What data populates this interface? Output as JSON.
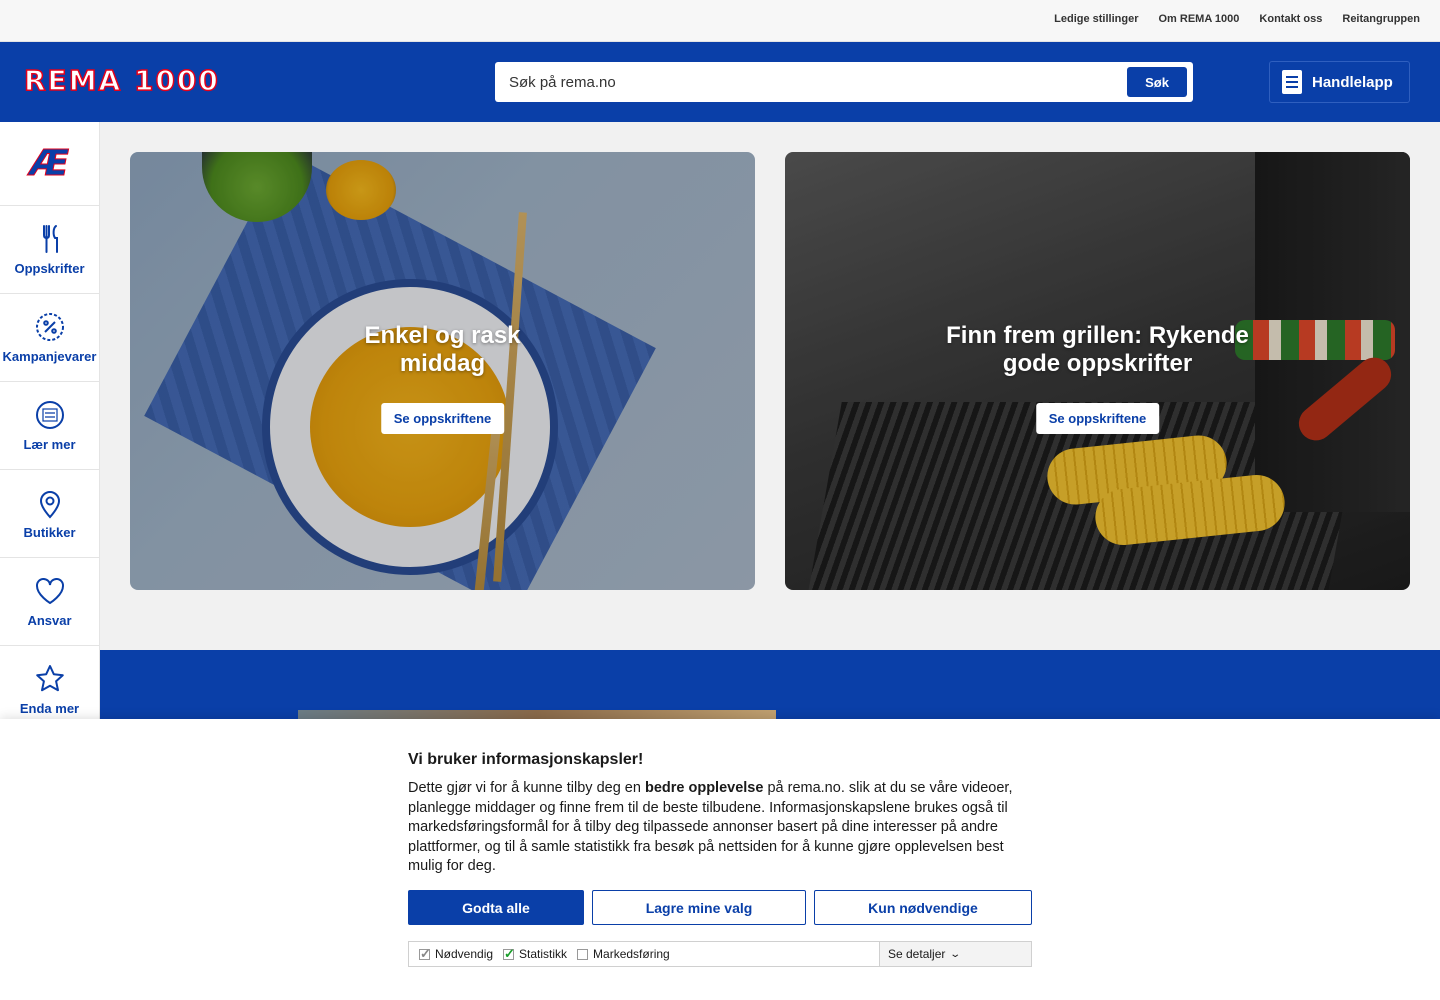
{
  "topbar": {
    "links": [
      "Ledige stillinger",
      "Om REMA 1000",
      "Kontakt oss",
      "Reitangruppen"
    ]
  },
  "header": {
    "logo": "REMA 1000",
    "search_placeholder": "Søk på rema.no",
    "search_button": "Søk",
    "shopping_list": "Handlelapp"
  },
  "sidebar": {
    "brand_mark": "Æ",
    "items": [
      {
        "label": "Oppskrifter",
        "icon": "cutlery-icon"
      },
      {
        "label": "Kampanjevarer",
        "icon": "percent-icon"
      },
      {
        "label": "Lær mer",
        "icon": "laer-mer-icon"
      },
      {
        "label": "Butikker",
        "icon": "location-pin-icon"
      },
      {
        "label": "Ansvar",
        "icon": "heart-icon"
      },
      {
        "label": "Enda mer",
        "icon": "star-icon"
      }
    ]
  },
  "cards": [
    {
      "title": "Enkel og rask middag",
      "button": "Se oppskriftene"
    },
    {
      "title": "Finn frem grillen: Rykende gode oppskrifter",
      "button": "Se oppskriftene"
    }
  ],
  "cookie": {
    "title": "Vi bruker informasjonskapsler!",
    "text_before": "Dette gjør vi for å kunne tilby deg en ",
    "text_bold": "bedre opplevelse",
    "text_after": " på rema.no. slik at du se våre videoer, planlegge middager og finne frem til de beste tilbudene. Informasjonskapslene brukes også til markedsføringsformål for å tilby deg tilpassede annonser basert på dine interesser på andre plattformer, og til å samle statistikk fra besøk på nettsiden for å kunne gjøre opplevelsen best mulig for deg.",
    "accept_all": "Godta alle",
    "save_choices": "Lagre mine valg",
    "only_necessary": "Kun nødvendige",
    "options": [
      {
        "label": "Nødvendig",
        "checked": true
      },
      {
        "label": "Statistikk",
        "checked": true
      },
      {
        "label": "Markedsføring",
        "checked": false
      }
    ],
    "details": "Se detaljer"
  },
  "colors": {
    "brand_blue": "#0a3fa8",
    "brand_red": "#e3001b",
    "check_green": "#1a9e2a"
  }
}
